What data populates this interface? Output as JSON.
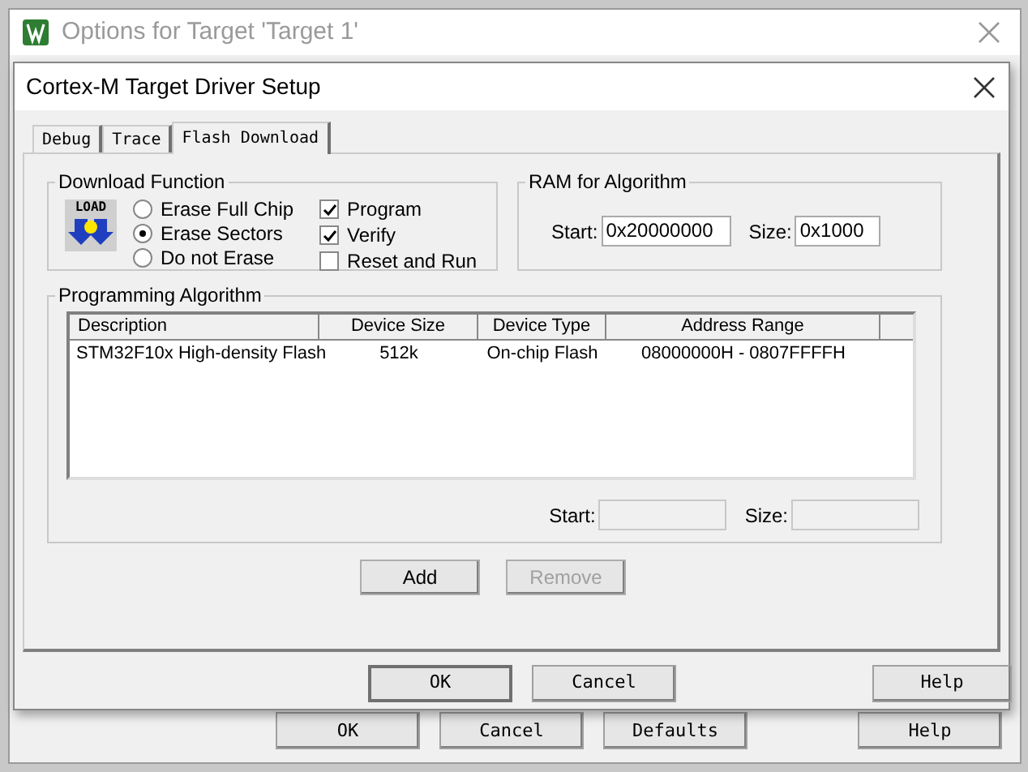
{
  "outer_window": {
    "title": "Options for Target 'Target 1'",
    "buttons": [
      {
        "label": "OK",
        "default": false
      },
      {
        "label": "Cancel",
        "default": false
      },
      {
        "label": "Defaults",
        "default": false
      },
      {
        "label": "Help",
        "default": false
      }
    ]
  },
  "dialog": {
    "title": "Cortex-M Target Driver Setup",
    "tabs": [
      {
        "label": "Debug",
        "selected": false
      },
      {
        "label": "Trace",
        "selected": false
      },
      {
        "label": "Flash Download",
        "selected": true
      }
    ],
    "download_function": {
      "title": "Download Function",
      "icon_label": "LOAD",
      "erase_options": [
        {
          "label": "Erase Full Chip",
          "selected": false
        },
        {
          "label": "Erase Sectors",
          "selected": true
        },
        {
          "label": "Do not Erase",
          "selected": false
        }
      ],
      "options": [
        {
          "label": "Program",
          "checked": true
        },
        {
          "label": "Verify",
          "checked": true
        },
        {
          "label": "Reset and Run",
          "checked": false
        }
      ]
    },
    "ram_for_algorithm": {
      "title": "RAM for Algorithm",
      "start": {
        "label": "Start:",
        "value": "0x20000000"
      },
      "size": {
        "label": "Size:",
        "value": "0x1000"
      }
    },
    "programming_algorithm": {
      "title": "Programming Algorithm",
      "columns": [
        "Description",
        "Device Size",
        "Device Type",
        "Address Range"
      ],
      "rows": [
        [
          "STM32F10x High-density Flash",
          "512k",
          "On-chip Flash",
          "08000000H - 0807FFFFH"
        ]
      ],
      "start": {
        "label": "Start:",
        "disabled": true
      },
      "size": {
        "label": "Size:",
        "disabled": true
      }
    },
    "actions": [
      {
        "label": "Add",
        "disabled": false
      },
      {
        "label": "Remove",
        "disabled": true
      }
    ],
    "buttons": [
      {
        "label": "OK",
        "default": true
      },
      {
        "label": "Cancel",
        "default": false
      },
      {
        "label": "Help",
        "default": false
      }
    ]
  }
}
